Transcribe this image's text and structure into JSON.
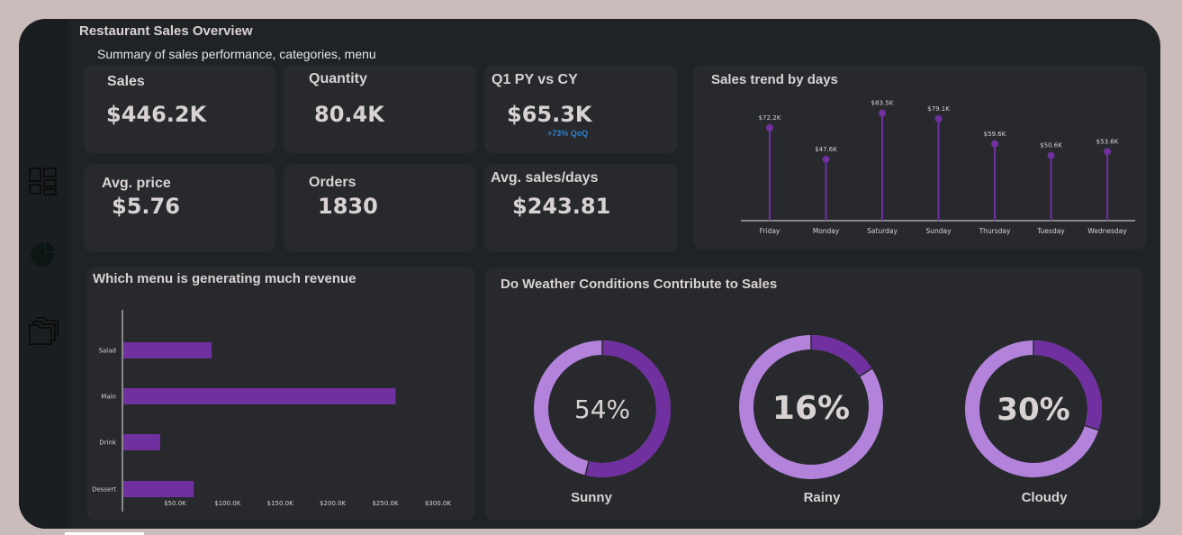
{
  "header": {
    "title": "Restaurant Sales Overview",
    "subtitle": "Summary of sales performance, categories, menu"
  },
  "sidebar": {
    "items": [
      {
        "icon": "dashboard-icon"
      },
      {
        "icon": "pie-chart-icon"
      },
      {
        "icon": "folders-icon"
      }
    ]
  },
  "kpis": {
    "sales": {
      "label": "Sales",
      "value": "$446.2K"
    },
    "quantity": {
      "label": "Quantity",
      "value": "80.4K"
    },
    "q1": {
      "label": "Q1 PY vs CY",
      "value": "$65.3K",
      "delta": "+73%  QoQ"
    },
    "avg_price": {
      "label": "Avg. price",
      "value": "$5.76"
    },
    "orders": {
      "label": "Orders",
      "value": "1830"
    },
    "avg_sales_days": {
      "label": "Avg. sales/days",
      "value": "$243.81"
    }
  },
  "colors": {
    "accent": "#7030a0",
    "accent_light": "#b383db",
    "card": "#27292d",
    "text": "#d9d2d2",
    "delta": "#2f7fd0"
  },
  "chart_data": [
    {
      "type": "line",
      "title": "Sales trend by days",
      "categories": [
        "Friday",
        "Monday",
        "Saturday",
        "Sunday",
        "Thursday",
        "Tuesday",
        "Wednesday"
      ],
      "values": [
        72.2,
        47.6,
        83.5,
        79.1,
        59.6,
        50.6,
        53.6
      ],
      "data_labels": [
        "$72.2K",
        "$47.6K",
        "$83.5K",
        "$79.1K",
        "$59.6K",
        "$50.6K",
        "$53.6K"
      ],
      "ylim": [
        0,
        100
      ],
      "grid": false
    },
    {
      "type": "bar",
      "title": "Which menu is generating much revenue",
      "categories": [
        "Salad",
        "Main",
        "Drink",
        "Dessert"
      ],
      "values": [
        84,
        259,
        35,
        67
      ],
      "xticks": [
        "$50.0K",
        "$100.0K",
        "$150.0K",
        "$200.0K",
        "$250.0K",
        "$300.0K"
      ],
      "xtick_values": [
        50,
        100,
        150,
        200,
        250,
        300
      ],
      "xlim": [
        0,
        300
      ],
      "grid": false
    },
    {
      "type": "pie",
      "title": "Do Weather Conditions Contribute to Sales",
      "donuts": [
        {
          "name": "Sunny",
          "percent": 54,
          "label": "54%"
        },
        {
          "name": "Rainy",
          "percent": 16,
          "label": "16%"
        },
        {
          "name": "Cloudy",
          "percent": 30,
          "label": "30%"
        }
      ]
    }
  ]
}
